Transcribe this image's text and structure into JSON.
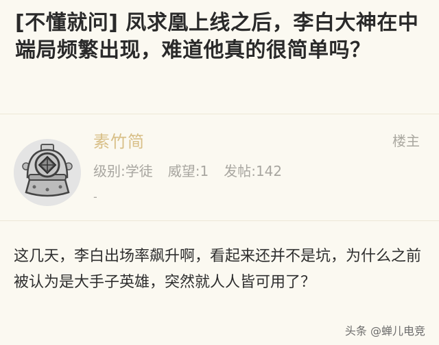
{
  "thread": {
    "title": "[不懂就问] 凤求凰上线之后，李白大神在中端局频繁出现，难道他真的很简单吗？"
  },
  "post": {
    "author": {
      "name": "素竹简",
      "avatar_icon": "diver-helmet-icon"
    },
    "floor_label": "楼主",
    "meta": {
      "level": "级别:学徒",
      "reputation": "威望:1",
      "posts": "发帖:142"
    },
    "dash": "-",
    "content": "这几天，李白出场率飙升啊，看起来还并不是坑，为什么之前被认为是大手子英雄，突然就人人皆可用了？"
  },
  "watermark": "头条 @蝉儿电竞",
  "colors": {
    "background": "#fbf9f1",
    "username": "#d8bf87",
    "meta_text": "#a8a6a0",
    "divider": "#ece7d6"
  }
}
